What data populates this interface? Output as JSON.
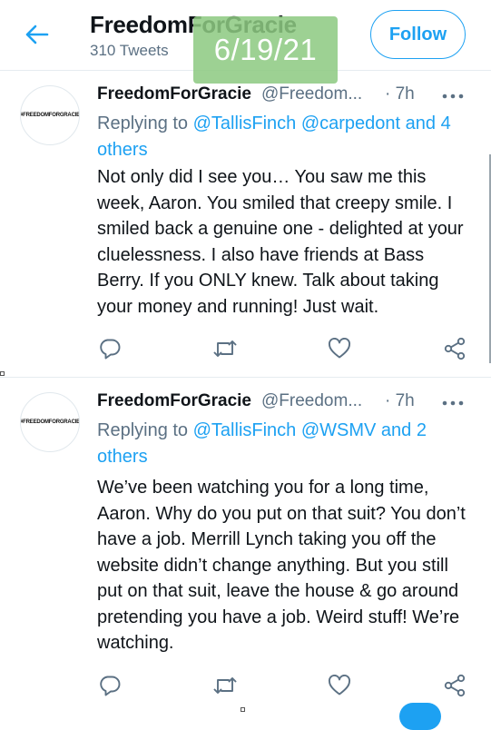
{
  "header": {
    "title": "FreedomForGracie",
    "subtitle": "310 Tweets",
    "follow_label": "Follow",
    "accent_color": "#1da1f2"
  },
  "stamp": {
    "date": "6/19/21",
    "color": "#8dc981"
  },
  "tweets": [
    {
      "avatar_text": "#FREEDOMFORGRACIE",
      "name": "FreedomForGracie",
      "handle": "@Freedom...",
      "time": "· 7h",
      "replying_prefix": "Replying to ",
      "replying_mentions": "@TallisFinch @carpedont and 4 others",
      "text": "Not only did I see you… You saw me this week, Aaron. You smiled that creepy smile. I smiled back a genuine one - delighted at your cluelessness. I also have friends at Bass Berry. If you ONLY knew. Talk about taking your money and running! Just wait."
    },
    {
      "avatar_text": "#FREEDOMFORGRACIE",
      "name": "FreedomForGracie",
      "handle": "@Freedom...",
      "time": "· 7h",
      "replying_prefix": "Replying to ",
      "replying_mentions": "@TallisFinch @WSMV and 2 others",
      "text": "We’ve been watching you for a long time, Aaron. Why do you put on that suit? You don’t have a job. Merrill Lynch taking you off the website didn’t change anything. But you still put on that suit, leave the house & go around pretending you have a job. Weird stuff! We’re watching."
    }
  ],
  "icons": {
    "back": "arrow-left-icon",
    "more": "more-dots-icon",
    "reply": "reply-icon",
    "retweet": "retweet-icon",
    "like": "heart-icon",
    "share": "share-icon"
  }
}
